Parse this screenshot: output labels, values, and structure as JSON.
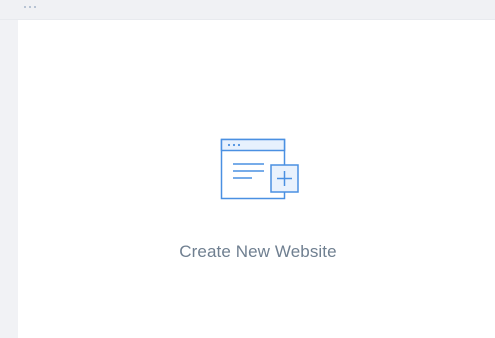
{
  "create_website": {
    "label": "Create New Website",
    "icon": "website-plus-icon",
    "accent_color": "#4a90e2",
    "text_color": "#6f7f90"
  },
  "window": {
    "titlebar_icon": "more-dots-icon"
  }
}
